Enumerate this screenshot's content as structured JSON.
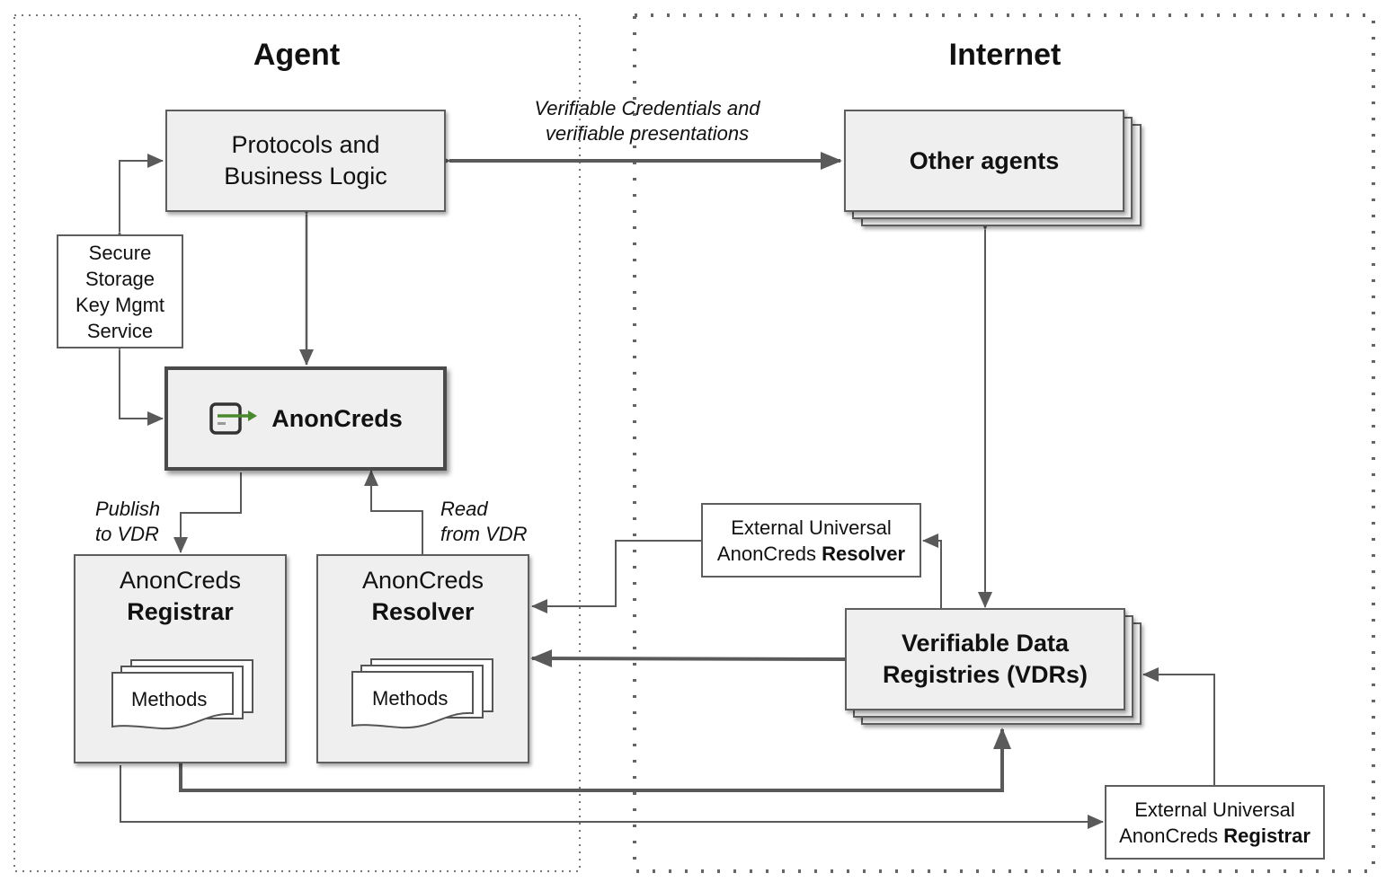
{
  "zones": {
    "agent": {
      "title": "Agent"
    },
    "internet": {
      "title": "Internet"
    }
  },
  "nodes": {
    "protocols": {
      "line1": "Protocols and",
      "line2": "Business Logic"
    },
    "secure_storage": {
      "lines": [
        "Secure",
        "Storage",
        "Key Mgmt",
        "Service"
      ]
    },
    "anoncreds": {
      "label": "AnonCreds",
      "icon": "anoncreds-logo-icon",
      "icon_accent": "#4a8a2e"
    },
    "registrar": {
      "line1": "AnonCreds",
      "line2": "Registrar",
      "methods": "Methods"
    },
    "resolver": {
      "line1": "AnonCreds",
      "line2": "Resolver",
      "methods": "Methods"
    },
    "other_agents": {
      "label": "Other agents"
    },
    "ext_resolver": {
      "line1": "External Universal",
      "line2_plain": "AnonCreds ",
      "line2_bold": "Resolver"
    },
    "vdrs": {
      "line1": "Verifiable Data",
      "line2": "Registries (VDRs)"
    },
    "ext_registrar": {
      "line1": "External Universal",
      "line2_plain": "AnonCreds ",
      "line2_bold": "Registrar"
    }
  },
  "edge_labels": {
    "vc": {
      "line1": "Verifiable Credentials and",
      "line2": "verifiable presentations"
    },
    "publish": {
      "line1": "Publish",
      "line2": "to VDR"
    },
    "read": {
      "line1": "Read",
      "line2": "from VDR"
    }
  },
  "colors": {
    "line": "#5a5a5a",
    "box_fill": "#efefef",
    "border": "#5e5e5e"
  }
}
